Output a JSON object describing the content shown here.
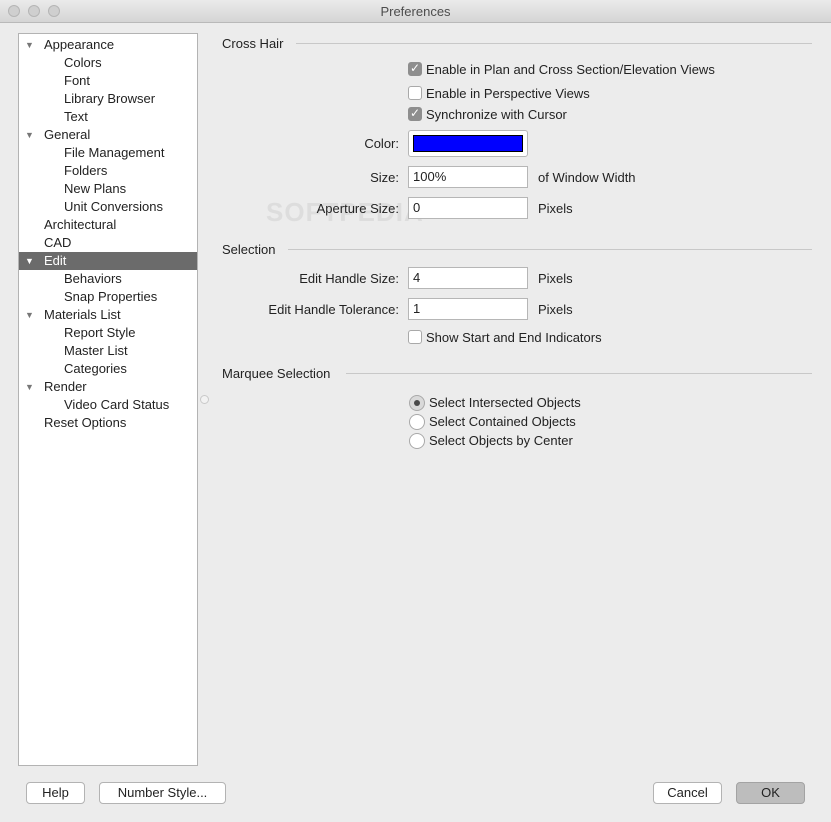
{
  "window": {
    "title": "Preferences"
  },
  "sidebar": {
    "items": [
      {
        "label": "Appearance",
        "level": 0,
        "expanded": true
      },
      {
        "label": "Colors",
        "level": 1
      },
      {
        "label": "Font",
        "level": 1
      },
      {
        "label": "Library Browser",
        "level": 1
      },
      {
        "label": "Text",
        "level": 1
      },
      {
        "label": "General",
        "level": 0,
        "expanded": true
      },
      {
        "label": "File Management",
        "level": 1
      },
      {
        "label": "Folders",
        "level": 1
      },
      {
        "label": "New Plans",
        "level": 1
      },
      {
        "label": "Unit Conversions",
        "level": 1
      },
      {
        "label": "Architectural",
        "level": 0
      },
      {
        "label": "CAD",
        "level": 0
      },
      {
        "label": "Edit",
        "level": 0,
        "expanded": true,
        "selected": true
      },
      {
        "label": "Behaviors",
        "level": 1
      },
      {
        "label": "Snap Properties",
        "level": 1
      },
      {
        "label": "Materials List",
        "level": 0,
        "expanded": true
      },
      {
        "label": "Report Style",
        "level": 1
      },
      {
        "label": "Master List",
        "level": 1
      },
      {
        "label": "Categories",
        "level": 1
      },
      {
        "label": "Render",
        "level": 0,
        "expanded": true
      },
      {
        "label": "Video Card Status",
        "level": 1
      },
      {
        "label": "Reset Options",
        "level": 0
      }
    ]
  },
  "crosshair": {
    "title": "Cross Hair",
    "enable_plan": {
      "label": "Enable in Plan and Cross Section/Elevation Views",
      "checked": true
    },
    "enable_perspective": {
      "label": "Enable in Perspective Views",
      "checked": false
    },
    "sync_cursor": {
      "label": "Synchronize with Cursor",
      "checked": true
    },
    "color_label": "Color:",
    "color_value": "#0000ff",
    "size_label": "Size:",
    "size_value": "100%",
    "size_unit": "of Window Width",
    "aperture_label": "Aperture Size:",
    "aperture_value": "0",
    "aperture_unit": "Pixels"
  },
  "selection": {
    "title": "Selection",
    "handle_size_label": "Edit Handle Size:",
    "handle_size_value": "4",
    "handle_size_unit": "Pixels",
    "handle_tol_label": "Edit Handle Tolerance:",
    "handle_tol_value": "1",
    "handle_tol_unit": "Pixels",
    "show_indicators": {
      "label": "Show Start and End Indicators",
      "checked": false
    }
  },
  "marquee": {
    "title": "Marquee Selection",
    "options": [
      {
        "label": "Select Intersected Objects",
        "selected": true
      },
      {
        "label": "Select Contained Objects",
        "selected": false
      },
      {
        "label": "Select Objects by Center",
        "selected": false
      }
    ]
  },
  "footer": {
    "help": "Help",
    "number_style": "Number Style...",
    "cancel": "Cancel",
    "ok": "OK"
  },
  "watermark": "SOFTPEDIA"
}
